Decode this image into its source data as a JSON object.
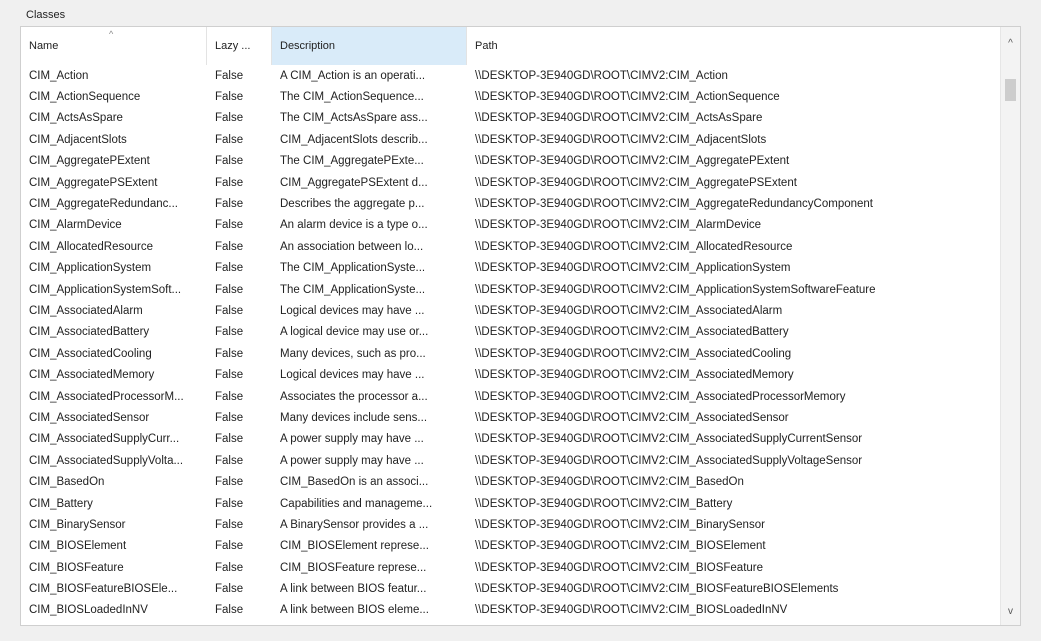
{
  "group_title": "Classes",
  "columns": {
    "name": "Name",
    "lazy": "Lazy ...",
    "description": "Description",
    "path": "Path"
  },
  "sort_indicator": "^",
  "scroll": {
    "up": "^",
    "down": "v"
  },
  "rows": [
    {
      "name": "CIM_Action",
      "lazy": "False",
      "description": "A CIM_Action is an operati...",
      "path": "\\\\DESKTOP-3E940GD\\ROOT\\CIMV2:CIM_Action"
    },
    {
      "name": "CIM_ActionSequence",
      "lazy": "False",
      "description": "The CIM_ActionSequence...",
      "path": "\\\\DESKTOP-3E940GD\\ROOT\\CIMV2:CIM_ActionSequence"
    },
    {
      "name": "CIM_ActsAsSpare",
      "lazy": "False",
      "description": "The CIM_ActsAsSpare ass...",
      "path": "\\\\DESKTOP-3E940GD\\ROOT\\CIMV2:CIM_ActsAsSpare"
    },
    {
      "name": "CIM_AdjacentSlots",
      "lazy": "False",
      "description": "CIM_AdjacentSlots describ...",
      "path": "\\\\DESKTOP-3E940GD\\ROOT\\CIMV2:CIM_AdjacentSlots"
    },
    {
      "name": "CIM_AggregatePExtent",
      "lazy": "False",
      "description": "The CIM_AggregatePExte...",
      "path": "\\\\DESKTOP-3E940GD\\ROOT\\CIMV2:CIM_AggregatePExtent"
    },
    {
      "name": "CIM_AggregatePSExtent",
      "lazy": "False",
      "description": "CIM_AggregatePSExtent d...",
      "path": "\\\\DESKTOP-3E940GD\\ROOT\\CIMV2:CIM_AggregatePSExtent"
    },
    {
      "name": "CIM_AggregateRedundanc...",
      "lazy": "False",
      "description": "Describes the aggregate p...",
      "path": "\\\\DESKTOP-3E940GD\\ROOT\\CIMV2:CIM_AggregateRedundancyComponent"
    },
    {
      "name": "CIM_AlarmDevice",
      "lazy": "False",
      "description": "An alarm device is a type o...",
      "path": "\\\\DESKTOP-3E940GD\\ROOT\\CIMV2:CIM_AlarmDevice"
    },
    {
      "name": "CIM_AllocatedResource",
      "lazy": "False",
      "description": "An association between lo...",
      "path": "\\\\DESKTOP-3E940GD\\ROOT\\CIMV2:CIM_AllocatedResource"
    },
    {
      "name": "CIM_ApplicationSystem",
      "lazy": "False",
      "description": "The CIM_ApplicationSyste...",
      "path": "\\\\DESKTOP-3E940GD\\ROOT\\CIMV2:CIM_ApplicationSystem"
    },
    {
      "name": "CIM_ApplicationSystemSoft...",
      "lazy": "False",
      "description": "The CIM_ApplicationSyste...",
      "path": "\\\\DESKTOP-3E940GD\\ROOT\\CIMV2:CIM_ApplicationSystemSoftwareFeature"
    },
    {
      "name": "CIM_AssociatedAlarm",
      "lazy": "False",
      "description": "Logical devices may have ...",
      "path": "\\\\DESKTOP-3E940GD\\ROOT\\CIMV2:CIM_AssociatedAlarm"
    },
    {
      "name": "CIM_AssociatedBattery",
      "lazy": "False",
      "description": "A logical device may use or...",
      "path": "\\\\DESKTOP-3E940GD\\ROOT\\CIMV2:CIM_AssociatedBattery"
    },
    {
      "name": "CIM_AssociatedCooling",
      "lazy": "False",
      "description": "Many devices, such as pro...",
      "path": "\\\\DESKTOP-3E940GD\\ROOT\\CIMV2:CIM_AssociatedCooling"
    },
    {
      "name": "CIM_AssociatedMemory",
      "lazy": "False",
      "description": "Logical devices may have ...",
      "path": "\\\\DESKTOP-3E940GD\\ROOT\\CIMV2:CIM_AssociatedMemory"
    },
    {
      "name": "CIM_AssociatedProcessorM...",
      "lazy": "False",
      "description": "Associates the processor a...",
      "path": "\\\\DESKTOP-3E940GD\\ROOT\\CIMV2:CIM_AssociatedProcessorMemory"
    },
    {
      "name": "CIM_AssociatedSensor",
      "lazy": "False",
      "description": "Many devices include sens...",
      "path": "\\\\DESKTOP-3E940GD\\ROOT\\CIMV2:CIM_AssociatedSensor"
    },
    {
      "name": "CIM_AssociatedSupplyCurr...",
      "lazy": "False",
      "description": "A power supply may have ...",
      "path": "\\\\DESKTOP-3E940GD\\ROOT\\CIMV2:CIM_AssociatedSupplyCurrentSensor"
    },
    {
      "name": "CIM_AssociatedSupplyVolta...",
      "lazy": "False",
      "description": "A power supply may have ...",
      "path": "\\\\DESKTOP-3E940GD\\ROOT\\CIMV2:CIM_AssociatedSupplyVoltageSensor"
    },
    {
      "name": "CIM_BasedOn",
      "lazy": "False",
      "description": "CIM_BasedOn is an associ...",
      "path": "\\\\DESKTOP-3E940GD\\ROOT\\CIMV2:CIM_BasedOn"
    },
    {
      "name": "CIM_Battery",
      "lazy": "False",
      "description": "Capabilities and manageme...",
      "path": "\\\\DESKTOP-3E940GD\\ROOT\\CIMV2:CIM_Battery"
    },
    {
      "name": "CIM_BinarySensor",
      "lazy": "False",
      "description": "A BinarySensor provides a ...",
      "path": "\\\\DESKTOP-3E940GD\\ROOT\\CIMV2:CIM_BinarySensor"
    },
    {
      "name": "CIM_BIOSElement",
      "lazy": "False",
      "description": "CIM_BIOSElement represe...",
      "path": "\\\\DESKTOP-3E940GD\\ROOT\\CIMV2:CIM_BIOSElement"
    },
    {
      "name": "CIM_BIOSFeature",
      "lazy": "False",
      "description": "CIM_BIOSFeature represe...",
      "path": "\\\\DESKTOP-3E940GD\\ROOT\\CIMV2:CIM_BIOSFeature"
    },
    {
      "name": "CIM_BIOSFeatureBIOSEle...",
      "lazy": "False",
      "description": "A link between BIOS featur...",
      "path": "\\\\DESKTOP-3E940GD\\ROOT\\CIMV2:CIM_BIOSFeatureBIOSElements"
    },
    {
      "name": "CIM_BIOSLoadedInNV",
      "lazy": "False",
      "description": "A link between BIOS eleme...",
      "path": "\\\\DESKTOP-3E940GD\\ROOT\\CIMV2:CIM_BIOSLoadedInNV"
    }
  ]
}
